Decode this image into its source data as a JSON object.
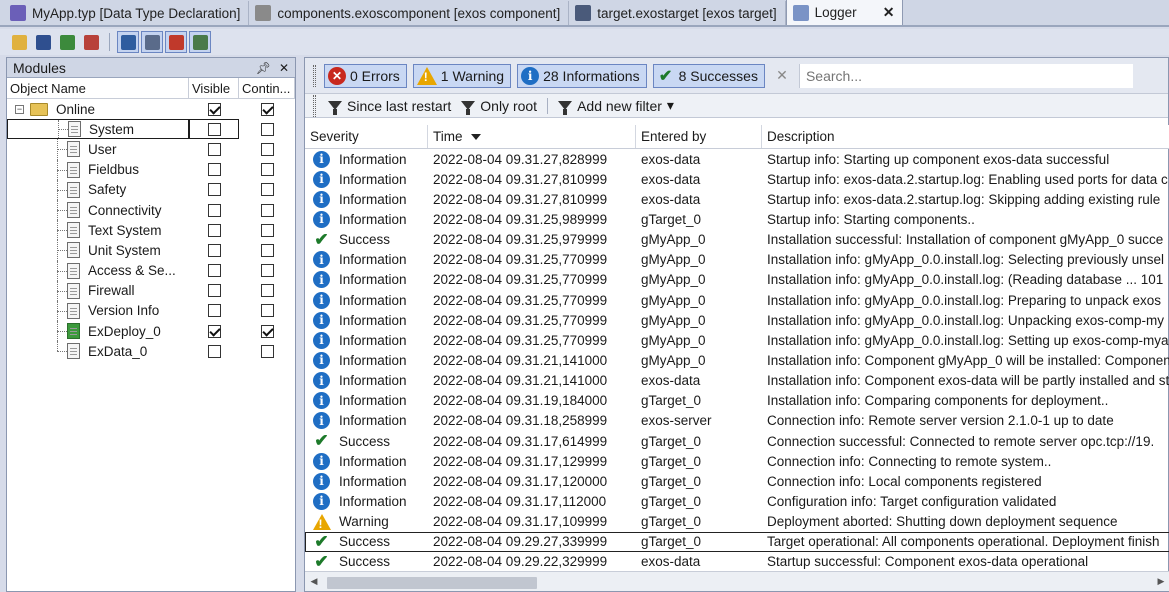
{
  "tabs": [
    {
      "label": "MyApp.typ [Data Type Declaration]",
      "icon": "type-icon",
      "color": "#6b5fb8"
    },
    {
      "label": "components.exoscomponent [exos component]",
      "icon": "component-icon",
      "color": "#8a8a8a"
    },
    {
      "label": "target.exostarget [exos target]",
      "icon": "target-icon",
      "color": "#4a5a7a"
    },
    {
      "label": "Logger",
      "icon": "logger-icon",
      "color": "#7a93c6"
    }
  ],
  "tab_close": "✕",
  "toolbar": {
    "icons": [
      "open-icon",
      "save-icon",
      "import-icon",
      "delete-icon",
      "tree-view-icon",
      "zoom-icon",
      "transfer-icon",
      "properties-icon"
    ]
  },
  "modules": {
    "title": "Modules",
    "pin": "ᵖ",
    "close": "✕",
    "headers": {
      "name": "Object Name",
      "visible": "Visible",
      "continuous": "Contin..."
    },
    "root": {
      "label": "Online",
      "expander": "−",
      "visible": true,
      "continuous": true
    },
    "items": [
      {
        "label": "System",
        "visible": false,
        "continuous": false,
        "selected": true
      },
      {
        "label": "User",
        "visible": false,
        "continuous": false
      },
      {
        "label": "Fieldbus",
        "visible": false,
        "continuous": false
      },
      {
        "label": "Safety",
        "visible": false,
        "continuous": false
      },
      {
        "label": "Connectivity",
        "visible": false,
        "continuous": false
      },
      {
        "label": "Text System",
        "visible": false,
        "continuous": false
      },
      {
        "label": "Unit System",
        "visible": false,
        "continuous": false
      },
      {
        "label": "Access & Se...",
        "visible": false,
        "continuous": false
      },
      {
        "label": "Firewall",
        "visible": false,
        "continuous": false
      },
      {
        "label": "Version Info",
        "visible": false,
        "continuous": false
      },
      {
        "label": "ExDeploy_0",
        "visible": true,
        "continuous": true,
        "deploy": true
      },
      {
        "label": "ExData_0",
        "visible": false,
        "continuous": false
      }
    ]
  },
  "logger": {
    "filters": {
      "errors": "0 Errors",
      "warnings": "1 Warning",
      "informations": "28 Informations",
      "successes": "8 Successes"
    },
    "search_placeholder": "Search...",
    "since_last_restart": "Since last restart",
    "only_root": "Only root",
    "add_new_filter": "Add new filter",
    "dropdown_arrow": "▾",
    "columns": {
      "severity": "Severity",
      "time": "Time",
      "entered_by": "Entered by",
      "description": "Description"
    },
    "rows": [
      {
        "severity": "Information",
        "type": "info",
        "time": "2022-08-04 09.31.27,828999",
        "by": "exos-data",
        "desc": "Startup info: Starting up component exos-data successful"
      },
      {
        "severity": "Information",
        "type": "info",
        "time": "2022-08-04 09.31.27,810999",
        "by": "exos-data",
        "desc": "Startup info: exos-data.2.startup.log: Enabling used ports for data c"
      },
      {
        "severity": "Information",
        "type": "info",
        "time": "2022-08-04 09.31.27,810999",
        "by": "exos-data",
        "desc": "Startup info: exos-data.2.startup.log: Skipping adding existing rule"
      },
      {
        "severity": "Information",
        "type": "info",
        "time": "2022-08-04 09.31.25,989999",
        "by": "gTarget_0",
        "desc": "Startup info: Starting components.."
      },
      {
        "severity": "Success",
        "type": "succ",
        "time": "2022-08-04 09.31.25,979999",
        "by": "gMyApp_0",
        "desc": "Installation successful: Installation of component gMyApp_0 succe"
      },
      {
        "severity": "Information",
        "type": "info",
        "time": "2022-08-04 09.31.25,770999",
        "by": "gMyApp_0",
        "desc": "Installation info: gMyApp_0.0.install.log: Selecting previously unsel"
      },
      {
        "severity": "Information",
        "type": "info",
        "time": "2022-08-04 09.31.25,770999",
        "by": "gMyApp_0",
        "desc": "Installation info: gMyApp_0.0.install.log: (Reading database ... 101"
      },
      {
        "severity": "Information",
        "type": "info",
        "time": "2022-08-04 09.31.25,770999",
        "by": "gMyApp_0",
        "desc": "Installation info: gMyApp_0.0.install.log: Preparing to unpack exos"
      },
      {
        "severity": "Information",
        "type": "info",
        "time": "2022-08-04 09.31.25,770999",
        "by": "gMyApp_0",
        "desc": "Installation info: gMyApp_0.0.install.log: Unpacking exos-comp-my"
      },
      {
        "severity": "Information",
        "type": "info",
        "time": "2022-08-04 09.31.25,770999",
        "by": "gMyApp_0",
        "desc": "Installation info: gMyApp_0.0.install.log: Setting up exos-comp-mya"
      },
      {
        "severity": "Information",
        "type": "info",
        "time": "2022-08-04 09.31.21,141000",
        "by": "gMyApp_0",
        "desc": "Installation info: Component gMyApp_0 will be installed: Componen"
      },
      {
        "severity": "Information",
        "type": "info",
        "time": "2022-08-04 09.31.21,141000",
        "by": "exos-data",
        "desc": "Installation info: Component exos-data will be partly installed and st"
      },
      {
        "severity": "Information",
        "type": "info",
        "time": "2022-08-04 09.31.19,184000",
        "by": "gTarget_0",
        "desc": "Installation info: Comparing components for deployment.."
      },
      {
        "severity": "Information",
        "type": "info",
        "time": "2022-08-04 09.31.18,258999",
        "by": "exos-server",
        "desc": "Connection info: Remote server version 2.1.0-1 up to date"
      },
      {
        "severity": "Success",
        "type": "succ",
        "time": "2022-08-04 09.31.17,614999",
        "by": "gTarget_0",
        "desc": "Connection successful: Connected to remote server opc.tcp://19."
      },
      {
        "severity": "Information",
        "type": "info",
        "time": "2022-08-04 09.31.17,129999",
        "by": "gTarget_0",
        "desc": "Connection info: Connecting to remote system.."
      },
      {
        "severity": "Information",
        "type": "info",
        "time": "2022-08-04 09.31.17,120000",
        "by": "gTarget_0",
        "desc": "Connection info: Local components registered"
      },
      {
        "severity": "Information",
        "type": "info",
        "time": "2022-08-04 09.31.17,112000",
        "by": "gTarget_0",
        "desc": "Configuration info: Target configuration validated"
      },
      {
        "severity": "Warning",
        "type": "warn",
        "time": "2022-08-04 09.31.17,109999",
        "by": "gTarget_0",
        "desc": "Deployment aborted: Shutting down deployment sequence"
      },
      {
        "severity": "Success",
        "type": "succ",
        "time": "2022-08-04 09.29.27,339999",
        "by": "gTarget_0",
        "desc": "Target operational: All components operational. Deployment finish",
        "selected": true
      },
      {
        "severity": "Success",
        "type": "succ",
        "time": "2022-08-04 09.29.22,329999",
        "by": "exos-data",
        "desc": "Startup successful: Component exos-data operational"
      }
    ]
  }
}
